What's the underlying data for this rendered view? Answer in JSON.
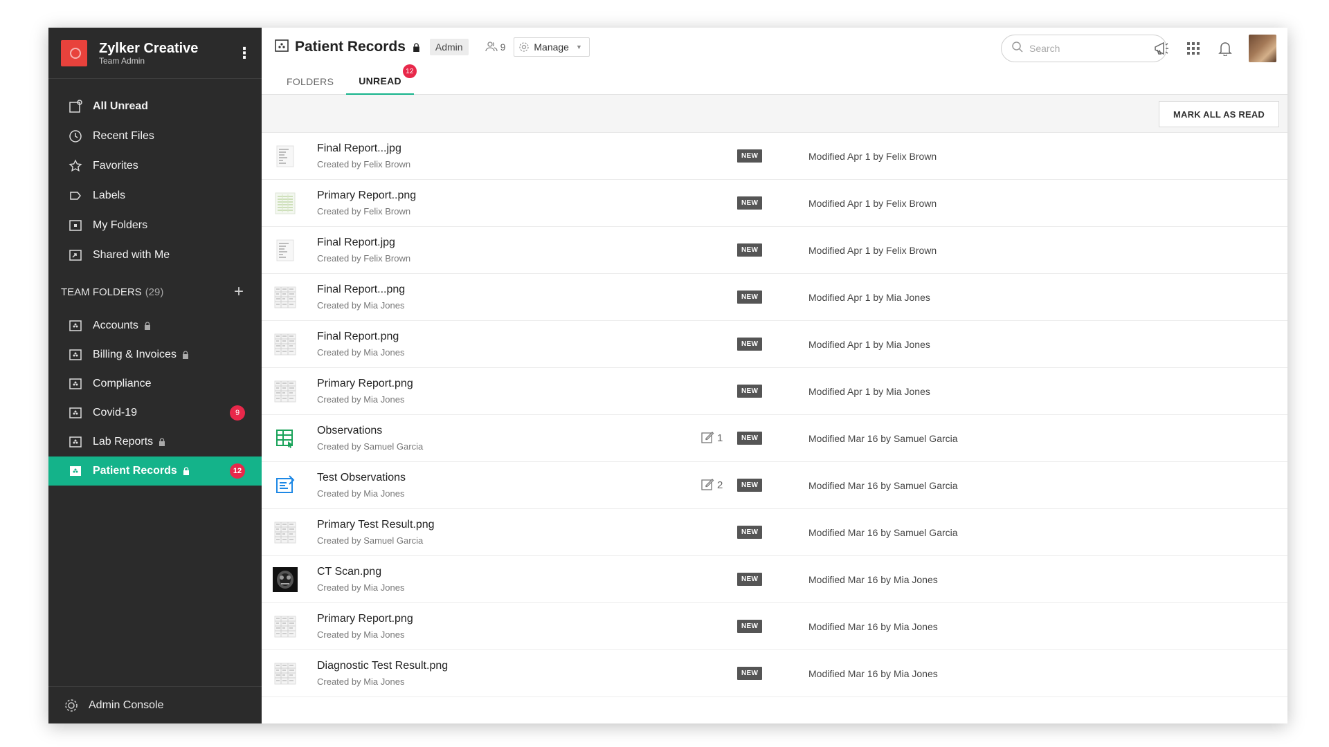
{
  "team": {
    "name": "Zylker Creative",
    "role": "Team Admin"
  },
  "nav": [
    {
      "label": "All Unread",
      "icon": "unread-icon",
      "bold": true
    },
    {
      "label": "Recent Files",
      "icon": "clock-icon"
    },
    {
      "label": "Favorites",
      "icon": "star-icon"
    },
    {
      "label": "Labels",
      "icon": "label-icon"
    },
    {
      "label": "My Folders",
      "icon": "folder-icon"
    },
    {
      "label": "Shared with Me",
      "icon": "shared-folder-icon"
    }
  ],
  "team_folders": {
    "title": "TEAM FOLDERS",
    "count": "(29)",
    "items": [
      {
        "label": "Accounts",
        "locked": true,
        "badge": ""
      },
      {
        "label": "Billing & Invoices",
        "locked": true,
        "badge": ""
      },
      {
        "label": "Compliance",
        "locked": false,
        "badge": ""
      },
      {
        "label": "Covid-19",
        "locked": false,
        "badge": "9"
      },
      {
        "label": "Lab Reports",
        "locked": true,
        "badge": ""
      },
      {
        "label": "Patient Records",
        "locked": true,
        "badge": "12",
        "active": true
      }
    ]
  },
  "admin_console": "Admin Console",
  "header": {
    "title": "Patient Records",
    "role": "Admin",
    "members": "9",
    "manage": "Manage",
    "tabs": [
      {
        "label": "FOLDERS",
        "badge": ""
      },
      {
        "label": "UNREAD",
        "badge": "12",
        "active": true
      }
    ],
    "search_placeholder": "Search"
  },
  "mark_all": "MARK ALL AS READ",
  "new_label": "NEW",
  "files": [
    {
      "name": "Final Report...jpg",
      "by": "Created by Felix Brown",
      "modified": "Modified Apr 1 by Felix Brown",
      "thumb": "doc-light",
      "comments": ""
    },
    {
      "name": "Primary Report..png",
      "by": "Created by Felix Brown",
      "modified": "Modified Apr 1 by Felix Brown",
      "thumb": "doc-green",
      "comments": ""
    },
    {
      "name": "Final Report.jpg",
      "by": "Created by Felix Brown",
      "modified": "Modified Apr 1 by Felix Brown",
      "thumb": "doc-light",
      "comments": ""
    },
    {
      "name": "Final Report...png",
      "by": "Created by Mia Jones",
      "modified": "Modified Apr 1 by Mia Jones",
      "thumb": "doc-grid",
      "comments": ""
    },
    {
      "name": "Final Report.png",
      "by": "Created by Mia Jones",
      "modified": "Modified Apr 1 by Mia Jones",
      "thumb": "doc-grid",
      "comments": ""
    },
    {
      "name": "Primary Report.png",
      "by": "Created by Mia Jones",
      "modified": "Modified Apr 1 by Mia Jones",
      "thumb": "doc-grid",
      "comments": ""
    },
    {
      "name": "Observations",
      "by": "Created by Samuel Garcia",
      "modified": "Modified Mar 16 by Samuel Garcia",
      "thumb": "sheet",
      "comments": "1"
    },
    {
      "name": "Test Observations",
      "by": "Created by Mia Jones",
      "modified": "Modified Mar 16 by Samuel Garcia",
      "thumb": "writer",
      "comments": "2"
    },
    {
      "name": "Primary Test Result.png",
      "by": "Created by Samuel Garcia",
      "modified": "Modified Mar 16 by Samuel Garcia",
      "thumb": "doc-grid",
      "comments": ""
    },
    {
      "name": "CT Scan.png",
      "by": "Created by Mia Jones",
      "modified": "Modified Mar 16 by Mia Jones",
      "thumb": "scan",
      "comments": ""
    },
    {
      "name": "Primary Report.png",
      "by": "Created by Mia Jones",
      "modified": "Modified Mar 16 by Mia Jones",
      "thumb": "doc-grid",
      "comments": ""
    },
    {
      "name": "Diagnostic Test Result.png",
      "by": "Created by Mia Jones",
      "modified": "Modified Mar 16 by Mia Jones",
      "thumb": "doc-grid",
      "comments": ""
    }
  ],
  "colors": {
    "accent": "#14b38a",
    "sidebar": "#2b2b2b",
    "badge": "#e8284a",
    "logo": "#e8423c"
  }
}
